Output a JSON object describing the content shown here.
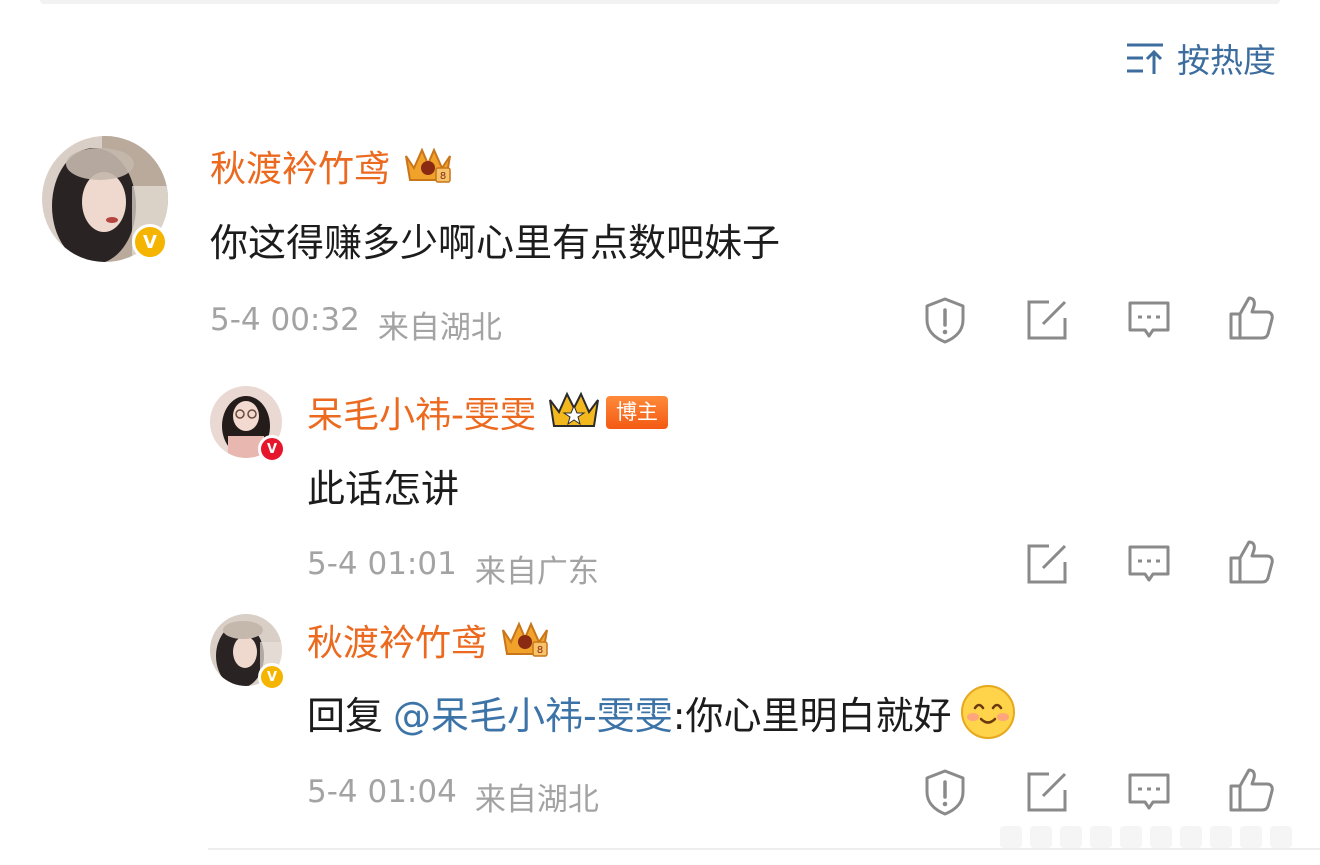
{
  "sort": {
    "label": "按热度",
    "icon": "sort-icon"
  },
  "comments": [
    {
      "username": "秋渡衿竹鸢",
      "badge": "crown-member-icon",
      "verified": "V",
      "text": "你这得赚多少啊心里有点数吧妹子",
      "time": "5-4 00:32",
      "location": "来自湖北"
    },
    {
      "username": "呆毛小祎-雯雯",
      "badge": "crown-member-icon",
      "host_tag": "博主",
      "verified": "V",
      "text": "此话怎讲",
      "time": "5-4 01:01",
      "location": "来自广东"
    },
    {
      "username": "秋渡衿竹鸢",
      "badge": "crown-member-icon",
      "verified": "V",
      "reply_prefix": "回复",
      "mention": "@呆毛小祎-雯雯",
      "reply_text": ":你心里明白就好",
      "emoji": "smile-emoji",
      "time": "5-4 01:04",
      "location": "来自湖北"
    }
  ],
  "colors": {
    "username": "#eb6a1f",
    "mention": "#3d74a8",
    "meta": "#a3a3a3",
    "sort": "#3d6d9e",
    "verified_gold": "#f5b400",
    "verified_red": "#e6162d"
  }
}
